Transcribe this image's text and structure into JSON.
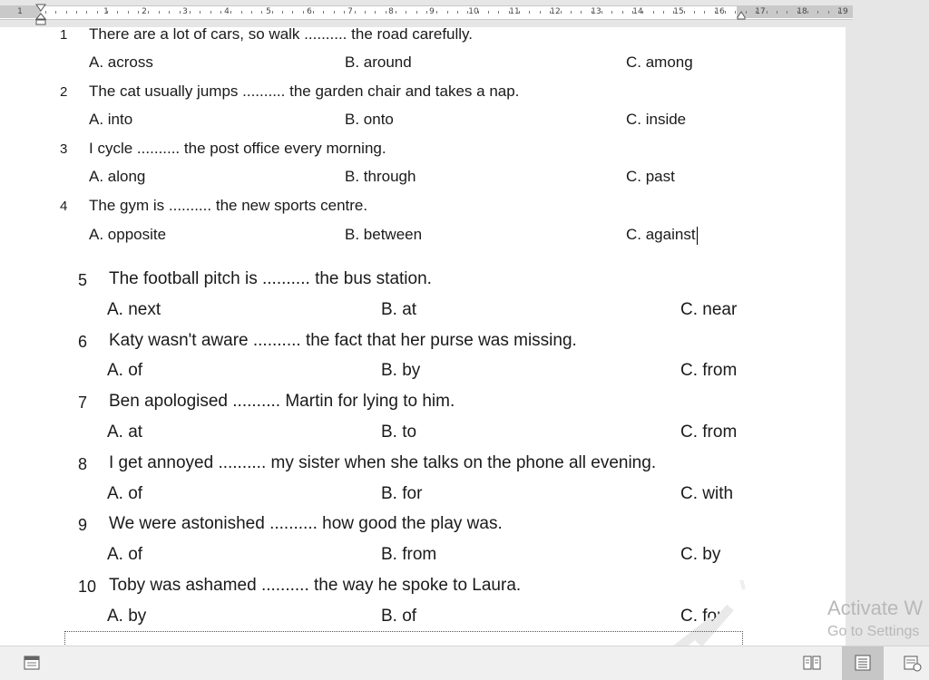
{
  "ruler": {
    "numbers": [
      "1",
      "1",
      "2",
      "3",
      "4",
      "5",
      "6",
      "7",
      "8",
      "9",
      "10",
      "11",
      "12",
      "13",
      "14",
      "15",
      "16",
      "17",
      "18",
      "19"
    ]
  },
  "questions": [
    {
      "num": "1",
      "stem_before": "There are a lot of cars, so walk",
      "blank": "..........",
      "stem_after": "the road carefully.",
      "a": "A. across",
      "b": "B. around",
      "c": "C. among"
    },
    {
      "num": "2",
      "stem_before": "The cat usually jumps",
      "blank": "..........",
      "stem_after": "the garden chair and takes a nap.",
      "a": "A. into",
      "b": "B. onto",
      "c": "C. inside"
    },
    {
      "num": "3",
      "stem_before": "I cycle",
      "blank": "..........",
      "stem_after": "the post office every morning.",
      "a": "A. along",
      "b": "B. through",
      "c": "C. past"
    },
    {
      "num": "4",
      "stem_before": "The gym is",
      "blank": "..........",
      "stem_after": "the new sports centre.",
      "a": "A. opposite",
      "b": "B. between",
      "c": "C. against"
    },
    {
      "num": "5",
      "stem_before": "The football pitch is",
      "blank": "..........",
      "stem_after": "the bus station.",
      "a": "A. next",
      "b": "B. at",
      "c": "C. near"
    },
    {
      "num": "6",
      "stem_before": "Katy wasn't aware",
      "blank": "..........",
      "stem_after": "the fact that her purse was missing.",
      "a": "A. of",
      "b": "B. by",
      "c": "C. from"
    },
    {
      "num": "7",
      "stem_before": "Ben apologised",
      "blank": "..........",
      "stem_after": "Martin for lying to him.",
      "a": "A. at",
      "b": "B. to",
      "c": "C. from"
    },
    {
      "num": "8",
      "stem_before": "I get annoyed",
      "blank": "..........",
      "stem_after": "my sister when she talks on the phone all evening.",
      "a": "A. of",
      "b": "B. for",
      "c": "C. with"
    },
    {
      "num": "9",
      "stem_before": "We were astonished",
      "blank": "..........",
      "stem_after": "how good the play was.",
      "a": "A. of",
      "b": "B. from",
      "c": "C. by"
    },
    {
      "num": "10",
      "stem_before": "Toby was ashamed",
      "blank": "..........",
      "stem_after": "the way he spoke to Laura.",
      "a": "A. by",
      "b": "B. of",
      "c": "C. for"
    }
  ],
  "activation": {
    "title": "Activate W",
    "subtitle": "Go to Settings"
  },
  "statusbar": {
    "icons": [
      "macro-icon",
      "read-mode-icon",
      "print-layout-icon",
      "web-layout-icon"
    ]
  }
}
